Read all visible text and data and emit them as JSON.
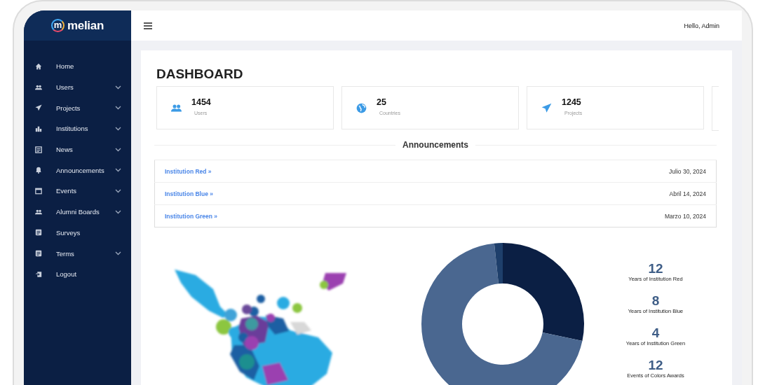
{
  "sidebar": {
    "logo": {
      "mark": "m",
      "name": "melian"
    },
    "items": [
      {
        "label": "Home",
        "expandable": false
      },
      {
        "label": "Users",
        "expandable": true
      },
      {
        "label": "Projects",
        "expandable": true
      },
      {
        "label": "Institutions",
        "expandable": true
      },
      {
        "label": "News",
        "expandable": true
      },
      {
        "label": "Announcements",
        "expandable": true
      },
      {
        "label": "Events",
        "expandable": true
      },
      {
        "label": "Alumni Boards",
        "expandable": true
      },
      {
        "label": "Surveys",
        "expandable": false
      },
      {
        "label": "Terms",
        "expandable": true
      },
      {
        "label": "Logout",
        "expandable": false
      }
    ]
  },
  "header": {
    "greeting": "Hello, Admin"
  },
  "page_title": "DASHBOARD",
  "stats": [
    {
      "value": "1454",
      "label": "Users"
    },
    {
      "value": "25",
      "label": "Countries"
    },
    {
      "value": "1245",
      "label": "Projects"
    }
  ],
  "announcements": {
    "title": "Announcements",
    "rows": [
      {
        "institution": "Institution Red »",
        "date": "Julio 30, 2024"
      },
      {
        "institution": "Institution Blue »",
        "date": "Abril 14, 2024"
      },
      {
        "institution": "Institution Green »",
        "date": "Marzo 10, 2024"
      }
    ]
  },
  "facts": [
    {
      "number": "12",
      "caption": "Years of Institution Red"
    },
    {
      "number": "8",
      "caption": "Years of Institution Blue"
    },
    {
      "number": "4",
      "caption": "Years of Institution Green"
    },
    {
      "number": "12",
      "caption": "Events of Colors Awards"
    }
  ]
}
